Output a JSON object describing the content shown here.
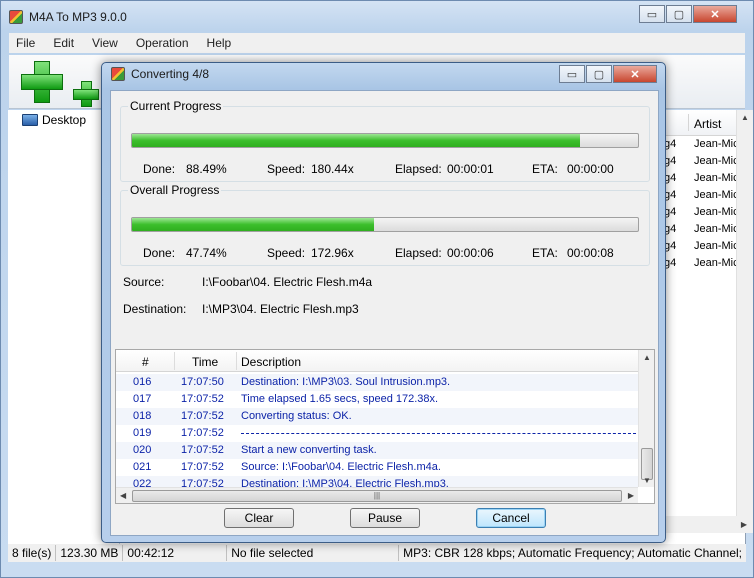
{
  "main": {
    "title": "M4A To MP3 9.0.0",
    "window_buttons": {
      "minimize": "▭",
      "maximize": "▢",
      "close": "✕"
    },
    "menu": [
      "File",
      "Edit",
      "View",
      "Operation",
      "Help"
    ],
    "tree": {
      "item": "Desktop"
    },
    "file_list": {
      "header_artist": "Artist",
      "rows": [
        {
          "ext": "g4",
          "artist": "Jean-Mic"
        },
        {
          "ext": "g4",
          "artist": "Jean-Mic"
        },
        {
          "ext": "g4",
          "artist": "Jean-Mic"
        },
        {
          "ext": "g4",
          "artist": "Jean-Mic"
        },
        {
          "ext": "g4",
          "artist": "Jean-Mic"
        },
        {
          "ext": "g4",
          "artist": "Jean-Mic"
        },
        {
          "ext": "g4",
          "artist": "Jean-Mic"
        },
        {
          "ext": "g4",
          "artist": "Jean-Mic"
        }
      ]
    },
    "status": {
      "files": "8 file(s)",
      "size": "123.30 MB",
      "duration": "00:42:12",
      "selection": "No file selected",
      "format": "MP3:  CBR 128 kbps; Automatic Frequency; Automatic Channel;"
    }
  },
  "dialog": {
    "title": "Converting 4/8",
    "window_buttons": {
      "minimize": "▭",
      "maximize": "▢",
      "close": "✕"
    },
    "current": {
      "legend": "Current Progress",
      "progress": 0.8849,
      "done_label": "Done:",
      "done": "88.49%",
      "speed_label": "Speed:",
      "speed": "180.44x",
      "elapsed_label": "Elapsed:",
      "elapsed": "00:00:01",
      "eta_label": "ETA:",
      "eta": "00:00:00"
    },
    "overall": {
      "legend": "Overall Progress",
      "progress": 0.4774,
      "done_label": "Done:",
      "done": "47.74%",
      "speed_label": "Speed:",
      "speed": "172.96x",
      "elapsed_label": "Elapsed:",
      "elapsed": "00:00:06",
      "eta_label": "ETA:",
      "eta": "00:00:08"
    },
    "source_label": "Source:",
    "source": "I:\\Foobar\\04. Electric Flesh.m4a",
    "destination_label": "Destination:",
    "destination": "I:\\MP3\\04. Electric Flesh.mp3",
    "log": {
      "headers": {
        "num": "#",
        "time": "Time",
        "desc": "Description"
      },
      "rows": [
        {
          "num": "016",
          "time": "17:07:50",
          "desc": "Destination: I:\\MP3\\03. Soul Intrusion.mp3."
        },
        {
          "num": "017",
          "time": "17:07:52",
          "desc": "Time elapsed 1.65 secs, speed 172.38x."
        },
        {
          "num": "018",
          "time": "17:07:52",
          "desc": "Converting status: OK."
        },
        {
          "num": "019",
          "time": "17:07:52",
          "desc": ""
        },
        {
          "num": "020",
          "time": "17:07:52",
          "desc": "Start a new converting task."
        },
        {
          "num": "021",
          "time": "17:07:52",
          "desc": "Source:  I:\\Foobar\\04. Electric Flesh.m4a."
        },
        {
          "num": "022",
          "time": "17:07:52",
          "desc": "Destination: I:\\MP3\\04. Electric Flesh.mp3."
        }
      ]
    },
    "buttons": {
      "clear": "Clear",
      "pause": "Pause",
      "cancel": "Cancel"
    }
  }
}
